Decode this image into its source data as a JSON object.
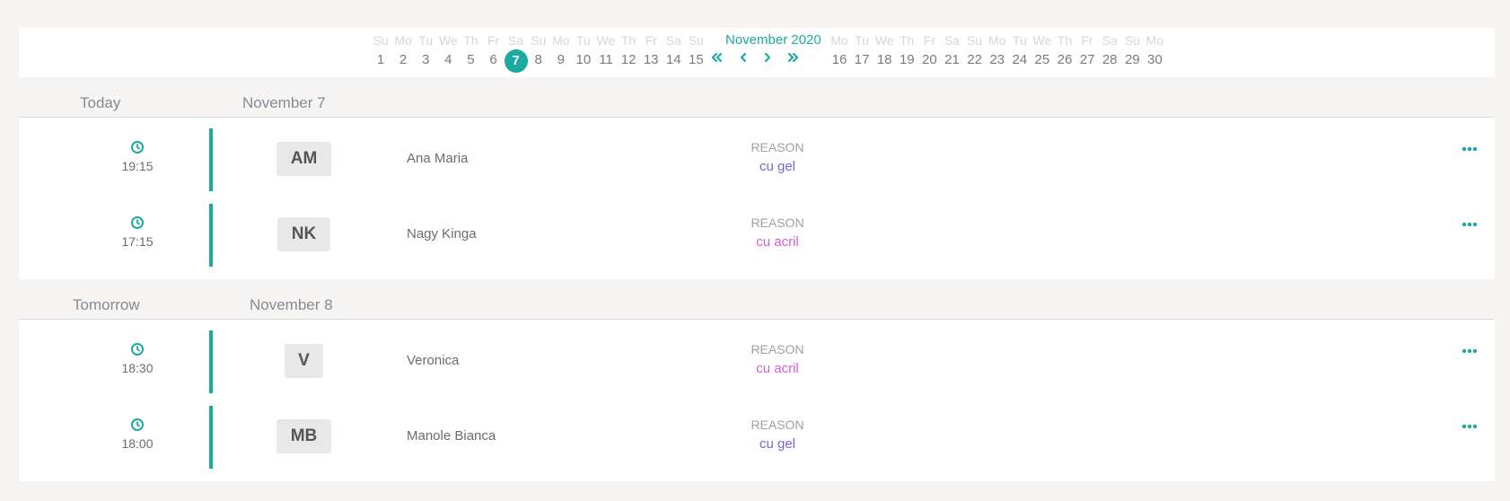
{
  "calendar": {
    "month_title": "November 2020",
    "days_left": [
      {
        "dow": "Su",
        "num": "1"
      },
      {
        "dow": "Mo",
        "num": "2"
      },
      {
        "dow": "Tu",
        "num": "3"
      },
      {
        "dow": "We",
        "num": "4"
      },
      {
        "dow": "Th",
        "num": "5"
      },
      {
        "dow": "Fr",
        "num": "6"
      },
      {
        "dow": "Sa",
        "num": "7",
        "selected": true
      },
      {
        "dow": "Su",
        "num": "8"
      },
      {
        "dow": "Mo",
        "num": "9"
      },
      {
        "dow": "Tu",
        "num": "10"
      },
      {
        "dow": "We",
        "num": "11"
      },
      {
        "dow": "Th",
        "num": "12"
      },
      {
        "dow": "Fr",
        "num": "13"
      },
      {
        "dow": "Sa",
        "num": "14"
      },
      {
        "dow": "Su",
        "num": "15"
      }
    ],
    "days_right": [
      {
        "dow": "Mo",
        "num": "16"
      },
      {
        "dow": "Tu",
        "num": "17"
      },
      {
        "dow": "We",
        "num": "18"
      },
      {
        "dow": "Th",
        "num": "19"
      },
      {
        "dow": "Fr",
        "num": "20"
      },
      {
        "dow": "Sa",
        "num": "21"
      },
      {
        "dow": "Su",
        "num": "22"
      },
      {
        "dow": "Mo",
        "num": "23"
      },
      {
        "dow": "Tu",
        "num": "24"
      },
      {
        "dow": "We",
        "num": "25"
      },
      {
        "dow": "Th",
        "num": "26"
      },
      {
        "dow": "Fr",
        "num": "27"
      },
      {
        "dow": "Sa",
        "num": "28"
      },
      {
        "dow": "Su",
        "num": "29"
      },
      {
        "dow": "Mo",
        "num": "30"
      }
    ],
    "nav_icons": [
      "double-chevron-left-icon",
      "chevron-left-icon",
      "chevron-right-icon",
      "double-chevron-right-icon"
    ]
  },
  "colors": {
    "accent": "#1aaaa0",
    "reason_gel": "#7a63d6",
    "reason_acril": "#d65fd0"
  },
  "sections": [
    {
      "label": "Today",
      "date": "November 7",
      "appointments": [
        {
          "time": "19:15",
          "initials": "AM",
          "name": "Ana Maria",
          "reason_label": "REASON",
          "reason": "cu gel",
          "reason_color": "#7a63d6"
        },
        {
          "time": "17:15",
          "initials": "NK",
          "name": "Nagy Kinga",
          "reason_label": "REASON",
          "reason": "cu acril",
          "reason_color": "#d65fd0"
        }
      ]
    },
    {
      "label": "Tomorrow",
      "date": "November 8",
      "appointments": [
        {
          "time": "18:30",
          "initials": "V",
          "name": "Veronica",
          "reason_label": "REASON",
          "reason": "cu acril",
          "reason_color": "#d65fd0"
        },
        {
          "time": "18:00",
          "initials": "MB",
          "name": "Manole Bianca",
          "reason_label": "REASON",
          "reason": "cu gel",
          "reason_color": "#7a63d6"
        }
      ]
    }
  ]
}
